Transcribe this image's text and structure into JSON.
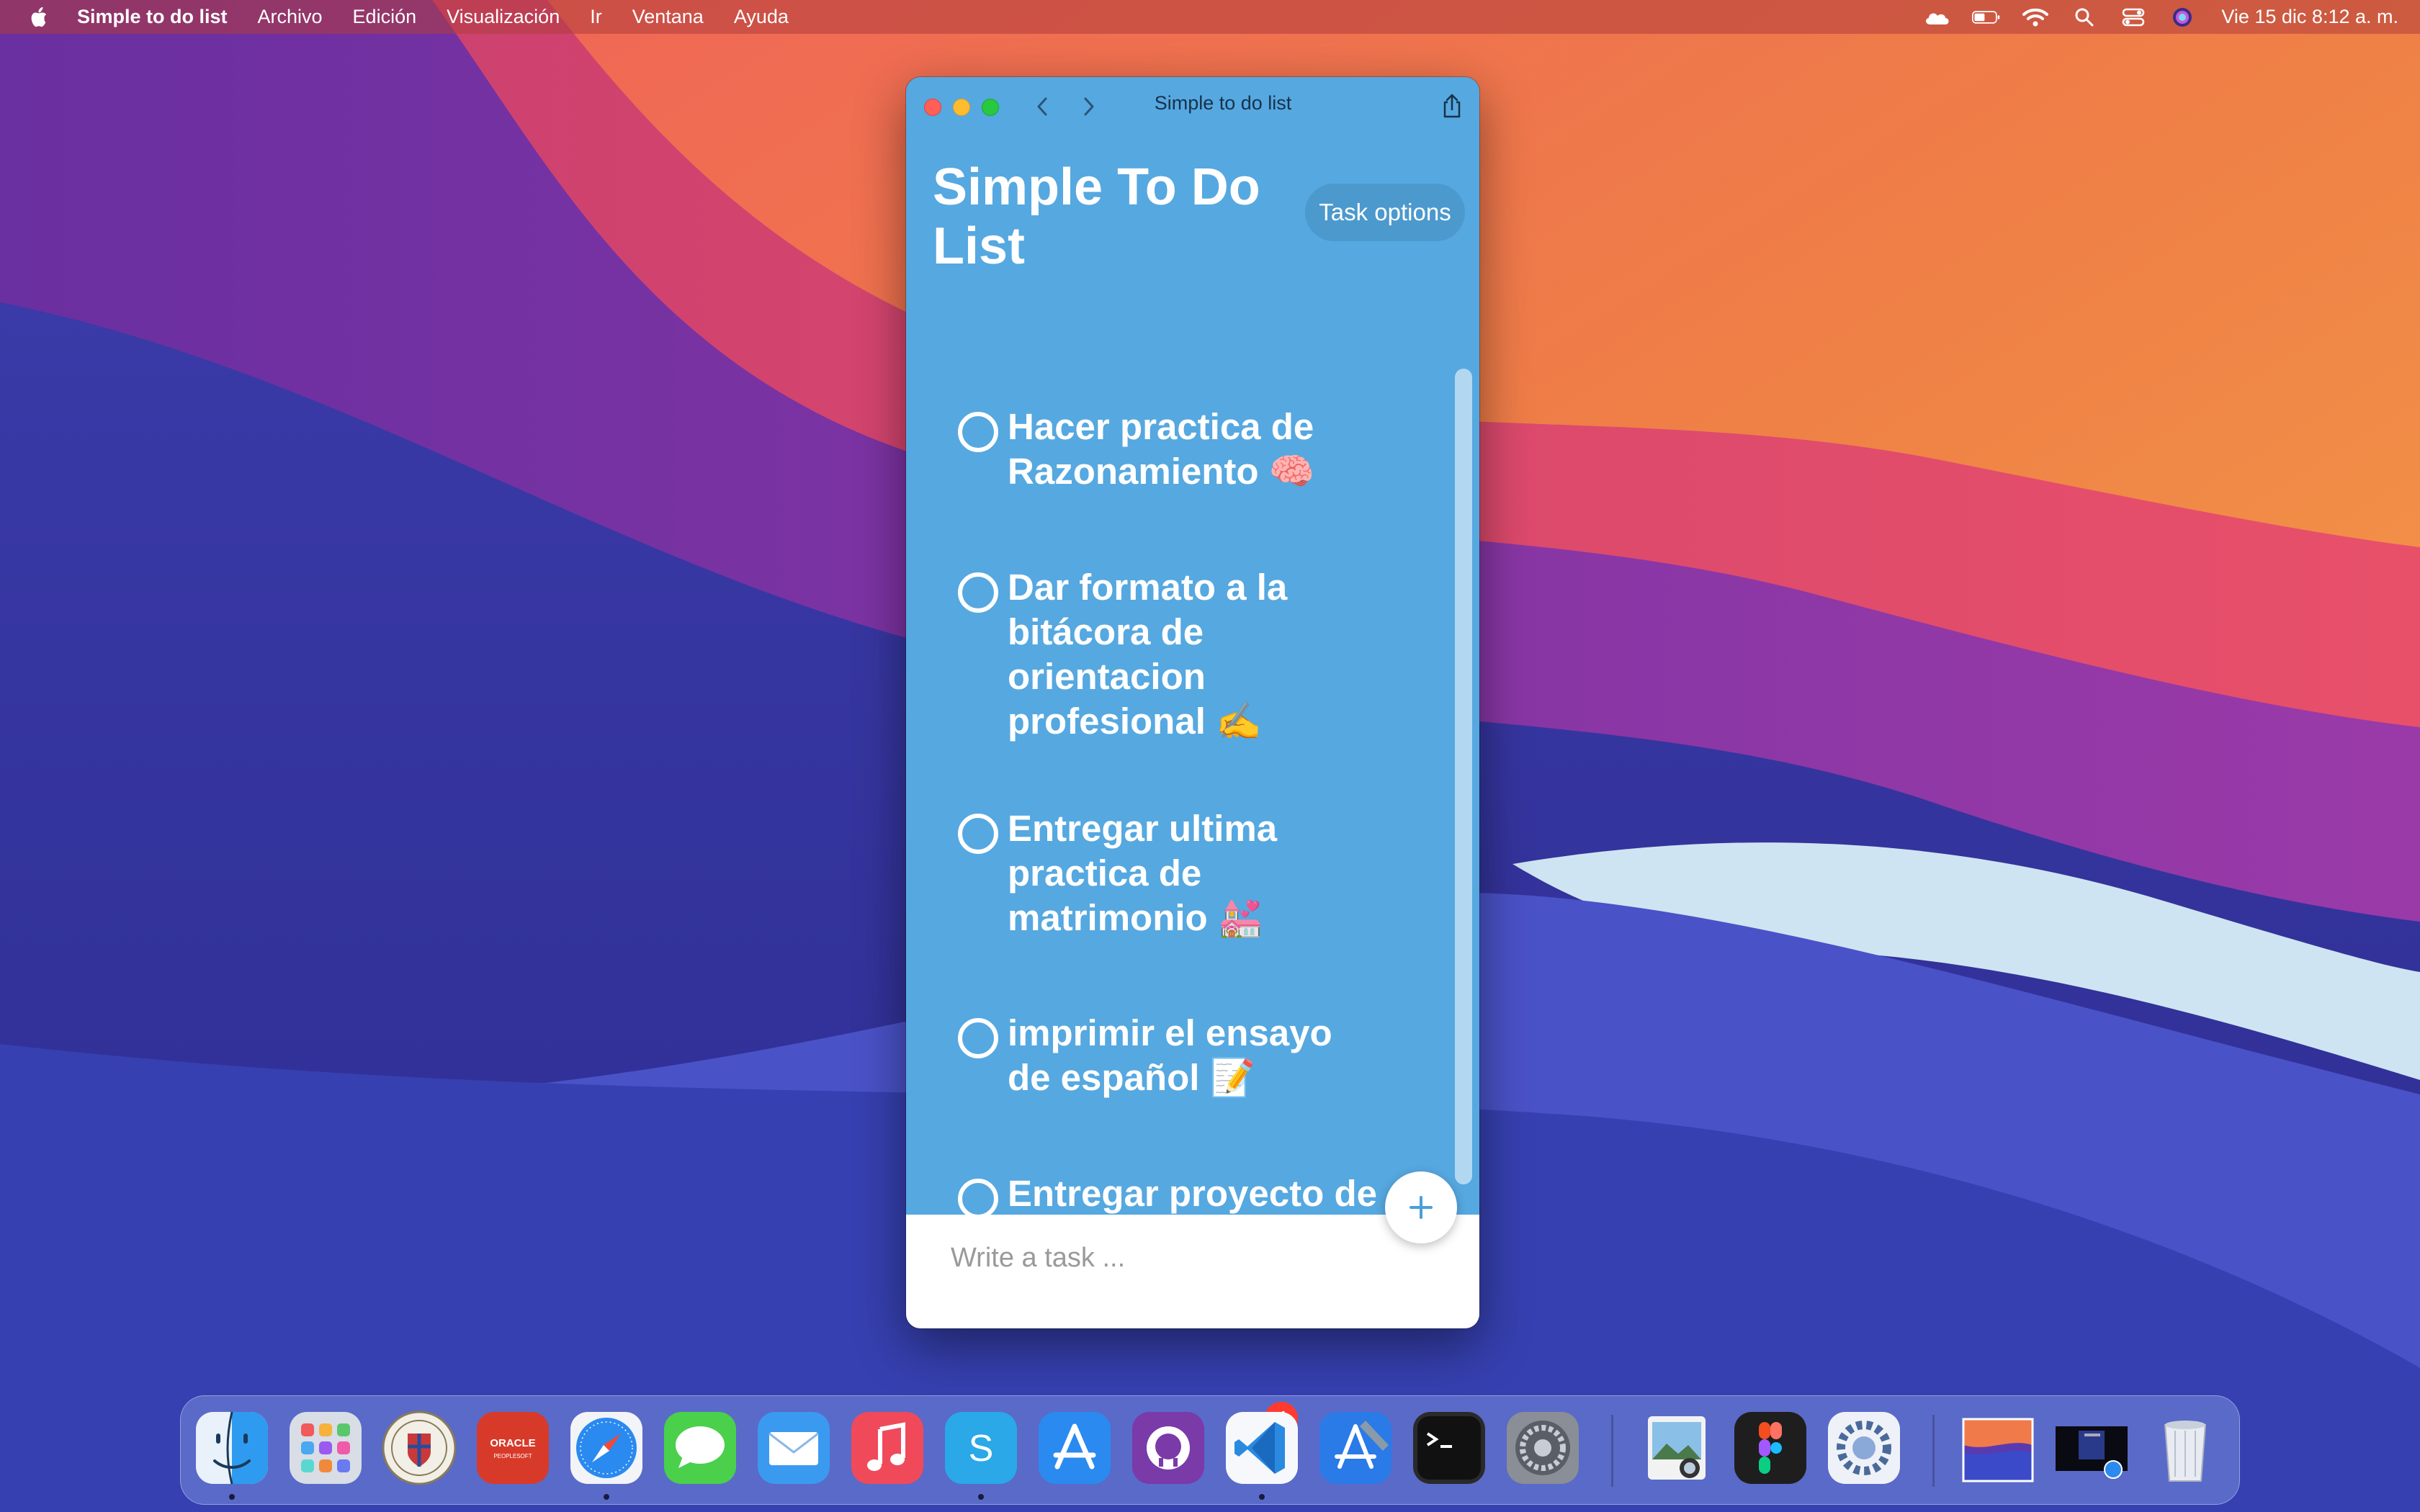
{
  "menubar": {
    "app_name": "Simple to do list",
    "menus": [
      "Archivo",
      "Edición",
      "Visualización",
      "Ir",
      "Ventana",
      "Ayuda"
    ],
    "clock": "Vie 15 dic  8:12 a. m."
  },
  "window": {
    "title": "Simple to do list",
    "app_title": "Simple To Do List",
    "task_options_label": "Task options",
    "tasks": [
      {
        "text": "Hacer practica de Razonamiento 🧠"
      },
      {
        "text": "Dar formato a la bitácora de orientacion profesional ✍️"
      },
      {
        "text": "Entregar ultima practica de matrimonio 💒"
      },
      {
        "text": "imprimir el ensayo de español 📝"
      },
      {
        "text": "Entregar proyecto de algoritmia 😓"
      }
    ],
    "input_placeholder": "Write a task ..."
  },
  "dock": {
    "items": [
      {
        "name": "finder-icon"
      },
      {
        "name": "launchpad-icon"
      },
      {
        "name": "school-crest-icon"
      },
      {
        "name": "oracle-peoplesoft-icon"
      },
      {
        "name": "safari-icon"
      },
      {
        "name": "messages-icon"
      },
      {
        "name": "mail-icon"
      },
      {
        "name": "music-icon"
      },
      {
        "name": "skype-icon"
      },
      {
        "name": "app-store-icon"
      },
      {
        "name": "github-desktop-icon"
      },
      {
        "name": "vscode-icon"
      },
      {
        "name": "xcode-icon"
      },
      {
        "name": "terminal-icon"
      },
      {
        "name": "system-preferences-icon"
      },
      {
        "name": "preview-icon"
      },
      {
        "name": "figma-icon"
      },
      {
        "name": "settings-gear-icon"
      },
      {
        "name": "wallpaper-thumb-icon"
      },
      {
        "name": "window-thumb-icon"
      },
      {
        "name": "trash-icon"
      }
    ],
    "app_store_badge": "4",
    "oracle_label": "ORACLE",
    "oracle_sublabel": "PEOPLESOFT",
    "skype_letter": "S"
  },
  "colors": {
    "window_bg": "#56a8e0",
    "accent_plus": "#4a9fd8",
    "close": "#ff5f57",
    "minimize": "#febc2e",
    "zoom": "#28c840"
  }
}
